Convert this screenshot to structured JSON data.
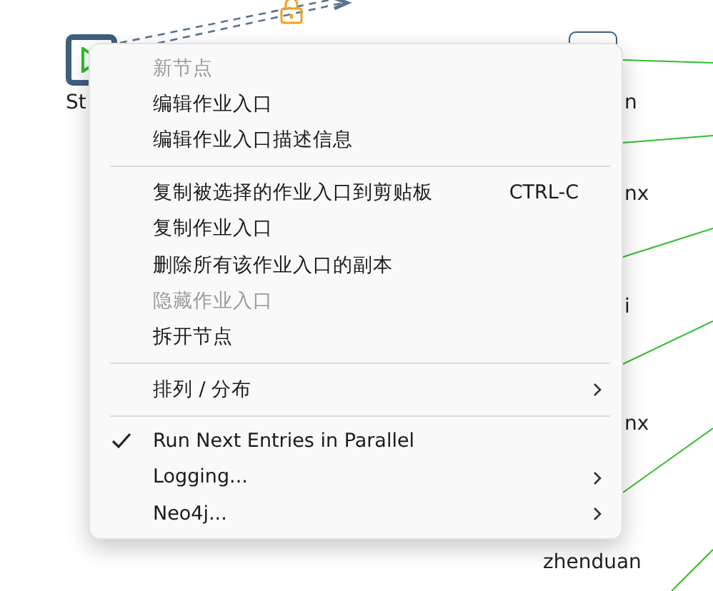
{
  "canvas": {
    "nodes": [
      {
        "label": "St",
        "kind": "start"
      },
      {
        "label": "n",
        "kind": "plain"
      },
      {
        "label": "nx",
        "kind": "text"
      },
      {
        "label": "i",
        "kind": "text"
      },
      {
        "label": "nx",
        "kind": "text"
      },
      {
        "label": "zhenduan",
        "kind": "text"
      }
    ]
  },
  "context_menu": {
    "items": [
      {
        "kind": "item",
        "label": "新节点",
        "disabled": true,
        "checked": false,
        "submenu": false
      },
      {
        "kind": "item",
        "label": "编辑作业入口",
        "disabled": false,
        "checked": false,
        "submenu": false
      },
      {
        "kind": "item",
        "label": "编辑作业入口描述信息",
        "disabled": false,
        "checked": false,
        "submenu": false
      },
      {
        "kind": "separator"
      },
      {
        "kind": "item",
        "label": "复制被选择的作业入口到剪贴板",
        "shortcut": "CTRL-C",
        "disabled": false,
        "checked": false,
        "submenu": false
      },
      {
        "kind": "item",
        "label": "复制作业入口",
        "disabled": false,
        "checked": false,
        "submenu": false
      },
      {
        "kind": "item",
        "label": "删除所有该作业入口的副本",
        "disabled": false,
        "checked": false,
        "submenu": false
      },
      {
        "kind": "item",
        "label": "隐藏作业入口",
        "disabled": true,
        "checked": false,
        "submenu": false
      },
      {
        "kind": "item",
        "label": "拆开节点",
        "disabled": false,
        "checked": false,
        "submenu": false
      },
      {
        "kind": "separator"
      },
      {
        "kind": "item",
        "label": "排列 / 分布",
        "disabled": false,
        "checked": false,
        "submenu": true
      },
      {
        "kind": "separator"
      },
      {
        "kind": "item",
        "label": "Run Next Entries in Parallel",
        "disabled": false,
        "checked": true,
        "submenu": false
      },
      {
        "kind": "item",
        "label": "Logging...",
        "disabled": false,
        "checked": false,
        "submenu": true
      },
      {
        "kind": "item",
        "label": "Neo4j...",
        "disabled": false,
        "checked": false,
        "submenu": true
      }
    ]
  }
}
